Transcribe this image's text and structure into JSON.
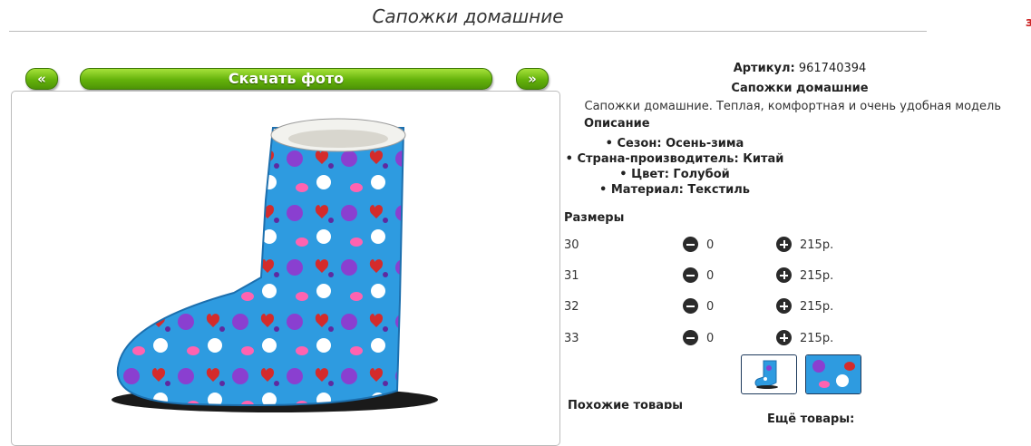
{
  "page": {
    "title": "Сапожки домашние",
    "corner_mark": "з"
  },
  "nav": {
    "prev_label": "«",
    "download_label": "Скачать фото",
    "next_label": "»"
  },
  "product": {
    "article_label": "Артикул:",
    "article_value": "961740394",
    "name": "Сапожки домашние",
    "description": "Сапожки домашние. Теплая, комфортная и очень удобная модель",
    "description_heading": "Описание",
    "attributes": [
      "Сезон: Осень-зима",
      "Страна-производитель: Китай",
      "Цвет: Голубой",
      "Материал: Текстиль"
    ]
  },
  "sizes": {
    "heading": "Размеры",
    "rows": [
      {
        "size": "30",
        "qty": "0",
        "price": "215р."
      },
      {
        "size": "31",
        "qty": "0",
        "price": "215р."
      },
      {
        "size": "32",
        "qty": "0",
        "price": "215р."
      },
      {
        "size": "33",
        "qty": "0",
        "price": "215р."
      }
    ]
  },
  "footer": {
    "similar_label": "Похожие товары",
    "more_label": "Ещё товары:"
  },
  "colors": {
    "button_green": "#64b20b",
    "boot_blue": "#2e9be0"
  },
  "icons": {
    "minus": "minus-circle-icon",
    "plus": "plus-circle-icon"
  }
}
